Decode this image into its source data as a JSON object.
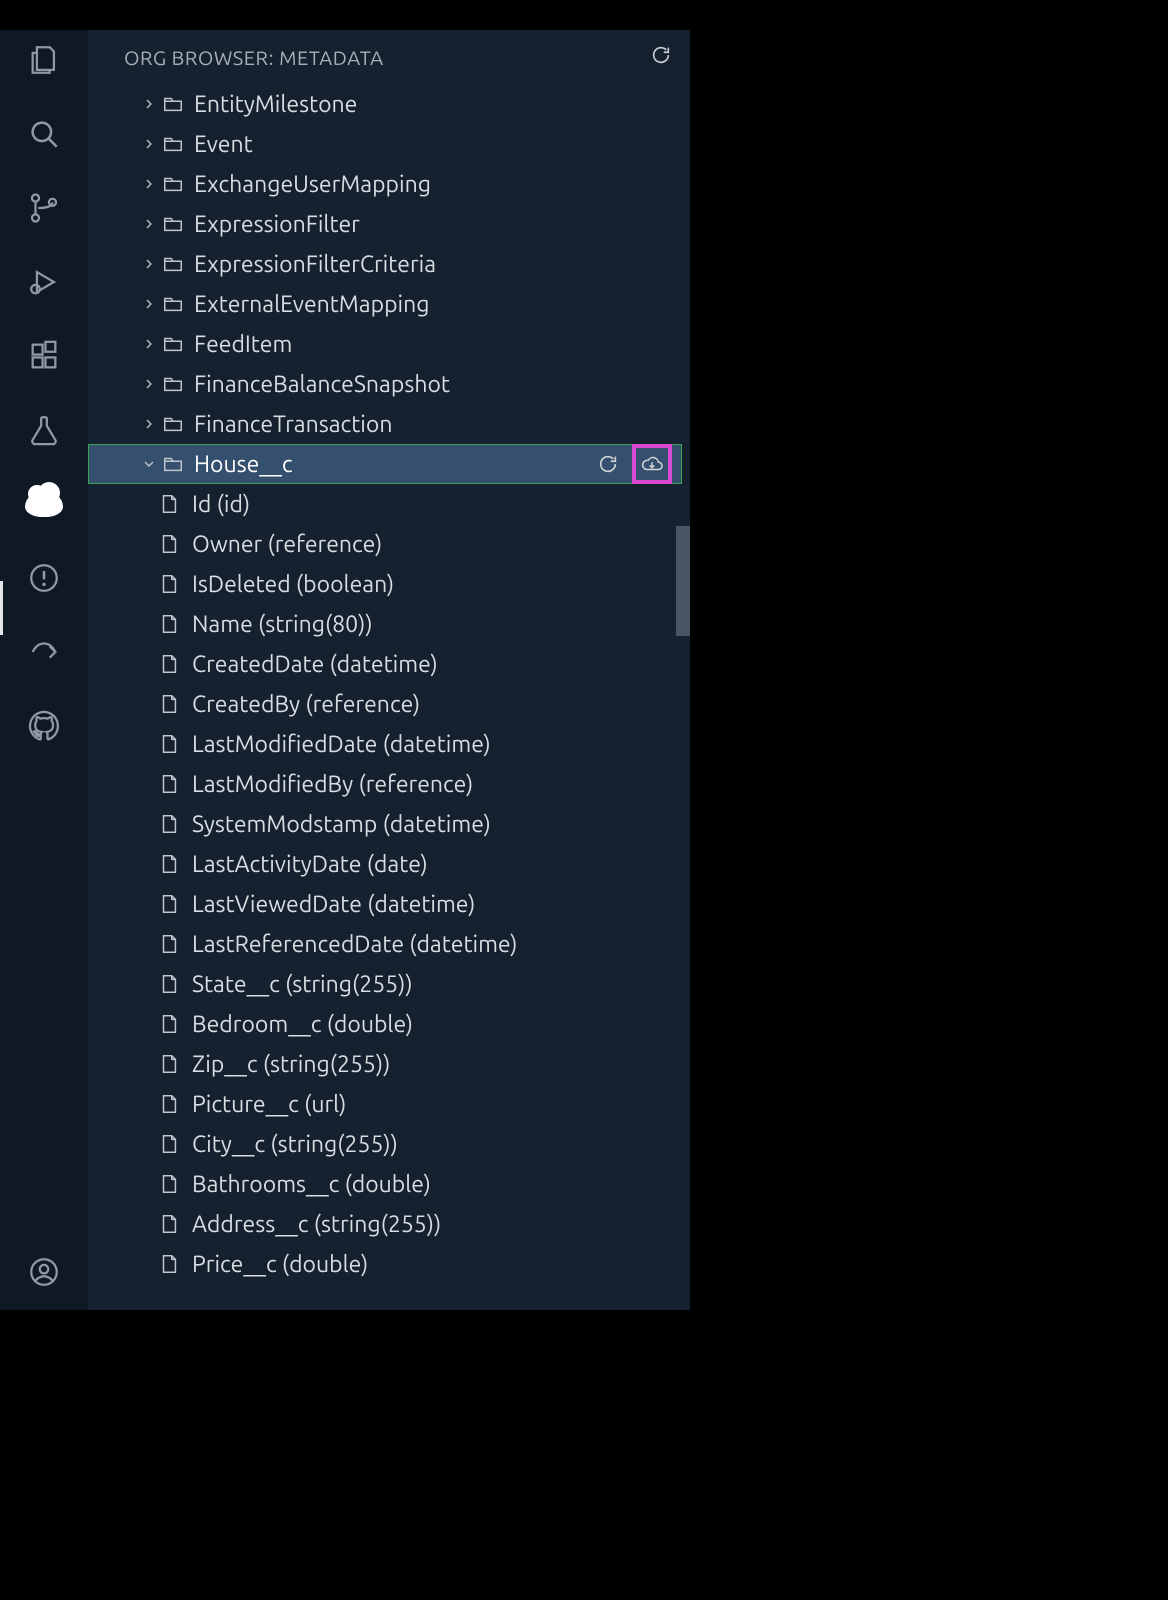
{
  "panel": {
    "title": "ORG BROWSER: METADATA"
  },
  "folders": [
    {
      "name": "EntityMilestone",
      "expanded": false
    },
    {
      "name": "Event",
      "expanded": false
    },
    {
      "name": "ExchangeUserMapping",
      "expanded": false
    },
    {
      "name": "ExpressionFilter",
      "expanded": false
    },
    {
      "name": "ExpressionFilterCriteria",
      "expanded": false
    },
    {
      "name": "ExternalEventMapping",
      "expanded": false
    },
    {
      "name": "FeedItem",
      "expanded": false
    },
    {
      "name": "FinanceBalanceSnapshot",
      "expanded": false
    },
    {
      "name": "FinanceTransaction",
      "expanded": false
    },
    {
      "name": "House__c",
      "expanded": true,
      "selected": true
    }
  ],
  "house_fields": [
    "Id (id)",
    "Owner (reference)",
    "IsDeleted (boolean)",
    "Name (string(80))",
    "CreatedDate (datetime)",
    "CreatedBy (reference)",
    "LastModifiedDate (datetime)",
    "LastModifiedBy (reference)",
    "SystemModstamp (datetime)",
    "LastActivityDate (date)",
    "LastViewedDate (datetime)",
    "LastReferencedDate (datetime)",
    "State__c (string(255))",
    "Bedroom__c (double)",
    "Zip__c (string(255))",
    "Picture__c (url)",
    "City__c (string(255))",
    "Bathrooms__c (double)",
    "Address__c (string(255))",
    "Price__c (double)"
  ]
}
